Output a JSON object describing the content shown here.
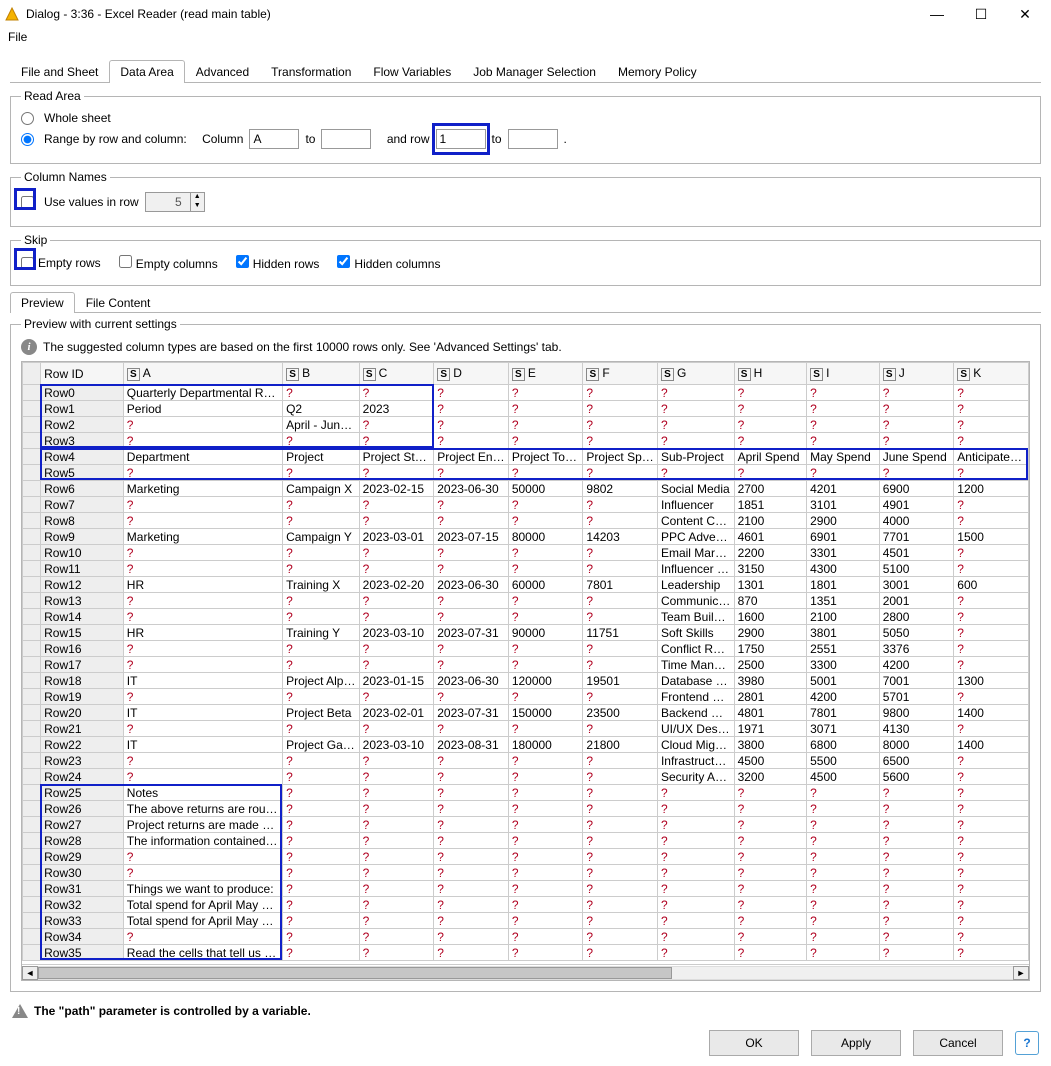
{
  "window": {
    "title": "Dialog - 3:36 - Excel Reader (read main table)"
  },
  "menu": {
    "file": "File"
  },
  "tabs": [
    "File and Sheet",
    "Data Area",
    "Advanced",
    "Transformation",
    "Flow Variables",
    "Job Manager Selection",
    "Memory Policy"
  ],
  "active_tab": "Data Area",
  "read_area": {
    "legend": "Read Area",
    "whole": "Whole sheet",
    "range": "Range by row and column:",
    "column_lbl": "Column",
    "column_from": "A",
    "column_to_lbl": "to",
    "column_to": "",
    "row_lbl": "and row",
    "row_from": "1",
    "row_to_lbl": "to",
    "row_to": "",
    "period": "."
  },
  "column_names": {
    "legend": "Column Names",
    "use_values": "Use values in row",
    "row_value": "5"
  },
  "skip": {
    "legend": "Skip",
    "empty_rows": "Empty rows",
    "empty_cols": "Empty columns",
    "hidden_rows": "Hidden rows",
    "hidden_cols": "Hidden columns"
  },
  "subtabs": [
    "Preview",
    "File Content"
  ],
  "active_subtab": "Preview",
  "preview": {
    "legend": "Preview with current settings",
    "info": "The suggested column types are based on the first 10000 rows only. See 'Advanced Settings' tab."
  },
  "table": {
    "cols": [
      "Row ID",
      "A",
      "B",
      "C",
      "D",
      "E",
      "F",
      "G",
      "H",
      "I",
      "J",
      "K"
    ],
    "rows": [
      {
        "id": "Row0",
        "c": [
          "Quarterly Departmental Return",
          "?",
          "?",
          "?",
          "?",
          "?",
          "?",
          "?",
          "?",
          "?",
          "?"
        ]
      },
      {
        "id": "Row1",
        "c": [
          "Period",
          "Q2",
          "2023",
          "?",
          "?",
          "?",
          "?",
          "?",
          "?",
          "?",
          "?"
        ]
      },
      {
        "id": "Row2",
        "c": [
          "?",
          "April - June ...",
          "?",
          "?",
          "?",
          "?",
          "?",
          "?",
          "?",
          "?",
          "?"
        ]
      },
      {
        "id": "Row3",
        "c": [
          "?",
          "?",
          "?",
          "?",
          "?",
          "?",
          "?",
          "?",
          "?",
          "?",
          "?"
        ]
      },
      {
        "id": "Row4",
        "c": [
          "Department",
          "Project",
          "Project Star...",
          "Project End ...",
          "Project Tota...",
          "Project Spe...",
          "Sub-Project",
          "April Spend",
          "May Spend",
          "June Spend",
          "Anticipated ..."
        ]
      },
      {
        "id": "Row5",
        "c": [
          "?",
          "?",
          "?",
          "?",
          "?",
          "?",
          "?",
          "?",
          "?",
          "?",
          "?"
        ]
      },
      {
        "id": "Row6",
        "c": [
          "Marketing",
          "Campaign X",
          "2023-02-15",
          "2023-06-30",
          "50000",
          "9802",
          "Social Media",
          "2700",
          "4201",
          "6900",
          "1200"
        ]
      },
      {
        "id": "Row7",
        "c": [
          "?",
          "?",
          "?",
          "?",
          "?",
          "?",
          "Influencer",
          "1851",
          "3101",
          "4901",
          "?"
        ]
      },
      {
        "id": "Row8",
        "c": [
          "?",
          "?",
          "?",
          "?",
          "?",
          "?",
          "Content Cre...",
          "2100",
          "2900",
          "4000",
          "?"
        ]
      },
      {
        "id": "Row9",
        "c": [
          "Marketing",
          "Campaign Y",
          "2023-03-01",
          "2023-07-15",
          "80000",
          "14203",
          "PPC Adverti...",
          "4601",
          "6901",
          "7701",
          "1500"
        ]
      },
      {
        "id": "Row10",
        "c": [
          "?",
          "?",
          "?",
          "?",
          "?",
          "?",
          "Email Market...",
          "2200",
          "3301",
          "4501",
          "?"
        ]
      },
      {
        "id": "Row11",
        "c": [
          "?",
          "?",
          "?",
          "?",
          "?",
          "?",
          "Influencer C...",
          "3150",
          "4300",
          "5100",
          "?"
        ]
      },
      {
        "id": "Row12",
        "c": [
          "HR",
          "Training X",
          "2023-02-20",
          "2023-06-30",
          "60000",
          "7801",
          "Leadership",
          "1301",
          "1801",
          "3001",
          "600"
        ]
      },
      {
        "id": "Row13",
        "c": [
          "?",
          "?",
          "?",
          "?",
          "?",
          "?",
          "Communication",
          "870",
          "1351",
          "2001",
          "?"
        ]
      },
      {
        "id": "Row14",
        "c": [
          "?",
          "?",
          "?",
          "?",
          "?",
          "?",
          "Team Building",
          "1600",
          "2100",
          "2800",
          "?"
        ]
      },
      {
        "id": "Row15",
        "c": [
          "HR",
          "Training Y",
          "2023-03-10",
          "2023-07-31",
          "90000",
          "11751",
          "Soft Skills",
          "2900",
          "3801",
          "5050",
          "?"
        ]
      },
      {
        "id": "Row16",
        "c": [
          "?",
          "?",
          "?",
          "?",
          "?",
          "?",
          "Conflict Res...",
          "1750",
          "2551",
          "3376",
          "?"
        ]
      },
      {
        "id": "Row17",
        "c": [
          "?",
          "?",
          "?",
          "?",
          "?",
          "?",
          "Time Manag...",
          "2500",
          "3300",
          "4200",
          "?"
        ]
      },
      {
        "id": "Row18",
        "c": [
          "IT",
          "Project Alpha",
          "2023-01-15",
          "2023-06-30",
          "120000",
          "19501",
          "Database Dev",
          "3980",
          "5001",
          "7001",
          "1300"
        ]
      },
      {
        "id": "Row19",
        "c": [
          "?",
          "?",
          "?",
          "?",
          "?",
          "?",
          "Frontend Dev",
          "2801",
          "4200",
          "5701",
          "?"
        ]
      },
      {
        "id": "Row20",
        "c": [
          "IT",
          "Project Beta",
          "2023-02-01",
          "2023-07-31",
          "150000",
          "23500",
          "Backend Dev",
          "4801",
          "7801",
          "9800",
          "1400"
        ]
      },
      {
        "id": "Row21",
        "c": [
          "?",
          "?",
          "?",
          "?",
          "?",
          "?",
          "UI/UX Design",
          "1971",
          "3071",
          "4130",
          "?"
        ]
      },
      {
        "id": "Row22",
        "c": [
          "IT",
          "Project Gamma",
          "2023-03-10",
          "2023-08-31",
          "180000",
          "21800",
          "Cloud Migrat...",
          "3800",
          "6800",
          "8000",
          "1400"
        ]
      },
      {
        "id": "Row23",
        "c": [
          "?",
          "?",
          "?",
          "?",
          "?",
          "?",
          "Infrastructure",
          "4500",
          "5500",
          "6500",
          "?"
        ]
      },
      {
        "id": "Row24",
        "c": [
          "?",
          "?",
          "?",
          "?",
          "?",
          "?",
          "Security Audit",
          "3200",
          "4500",
          "5600",
          "?"
        ]
      },
      {
        "id": "Row25",
        "c": [
          "Notes",
          "?",
          "?",
          "?",
          "?",
          "?",
          "?",
          "?",
          "?",
          "?",
          "?"
        ]
      },
      {
        "id": "Row26",
        "c": [
          "The above returns are round...",
          "?",
          "?",
          "?",
          "?",
          "?",
          "?",
          "?",
          "?",
          "?",
          "?"
        ]
      },
      {
        "id": "Row27",
        "c": [
          "Project returns are made on t...",
          "?",
          "?",
          "?",
          "?",
          "?",
          "?",
          "?",
          "?",
          "?",
          "?"
        ]
      },
      {
        "id": "Row28",
        "c": [
          "The information contained in ...",
          "?",
          "?",
          "?",
          "?",
          "?",
          "?",
          "?",
          "?",
          "?",
          "?"
        ]
      },
      {
        "id": "Row29",
        "c": [
          "?",
          "?",
          "?",
          "?",
          "?",
          "?",
          "?",
          "?",
          "?",
          "?",
          "?"
        ]
      },
      {
        "id": "Row30",
        "c": [
          "?",
          "?",
          "?",
          "?",
          "?",
          "?",
          "?",
          "?",
          "?",
          "?",
          "?"
        ]
      },
      {
        "id": "Row31",
        "c": [
          "Things we want to produce:",
          "?",
          "?",
          "?",
          "?",
          "?",
          "?",
          "?",
          "?",
          "?",
          "?"
        ]
      },
      {
        "id": "Row32",
        "c": [
          "Total spend for April May and...",
          "?",
          "?",
          "?",
          "?",
          "?",
          "?",
          "?",
          "?",
          "?",
          "?"
        ]
      },
      {
        "id": "Row33",
        "c": [
          "Total spend for April May and...",
          "?",
          "?",
          "?",
          "?",
          "?",
          "?",
          "?",
          "?",
          "?",
          "?"
        ]
      },
      {
        "id": "Row34",
        "c": [
          "?",
          "?",
          "?",
          "?",
          "?",
          "?",
          "?",
          "?",
          "?",
          "?",
          "?"
        ]
      },
      {
        "id": "Row35",
        "c": [
          "Read the cells that tell us the...",
          "?",
          "?",
          "?",
          "?",
          "?",
          "?",
          "?",
          "?",
          "?",
          "?"
        ]
      }
    ]
  },
  "warning": "The \"path\" parameter is controlled by a variable.",
  "buttons": {
    "ok": "OK",
    "apply": "Apply",
    "cancel": "Cancel",
    "help": "?"
  }
}
